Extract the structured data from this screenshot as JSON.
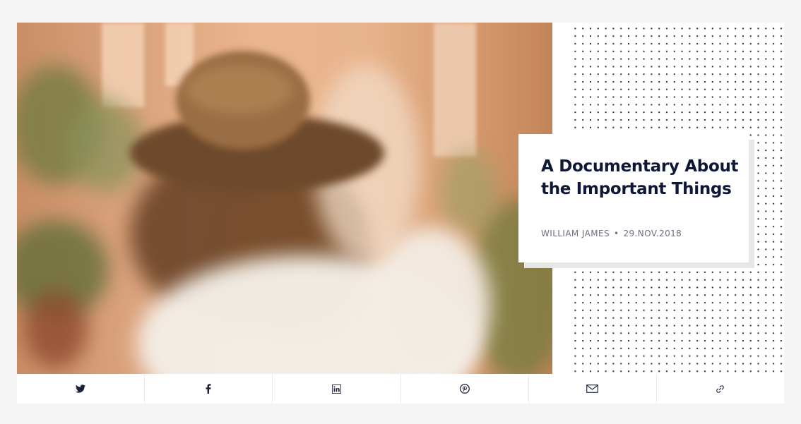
{
  "article": {
    "title": "A Documentary About the Important Things",
    "author": "WILLIAM JAMES",
    "separator": "•",
    "date": "29.NOV.2018",
    "image": "photo of a woman with long hair wearing a brown hat and white shirt"
  },
  "share_buttons": [
    {
      "icon": "twitter-icon"
    },
    {
      "icon": "facebook-icon"
    },
    {
      "icon": "linkedin-icon"
    },
    {
      "icon": "pinterest-icon"
    },
    {
      "icon": "email-icon"
    },
    {
      "icon": "link-icon"
    }
  ],
  "colors": {
    "title": "#0f1736",
    "meta": "#6b6f7b",
    "icons": "#1b2036",
    "page_background": "#f5f5f5"
  }
}
